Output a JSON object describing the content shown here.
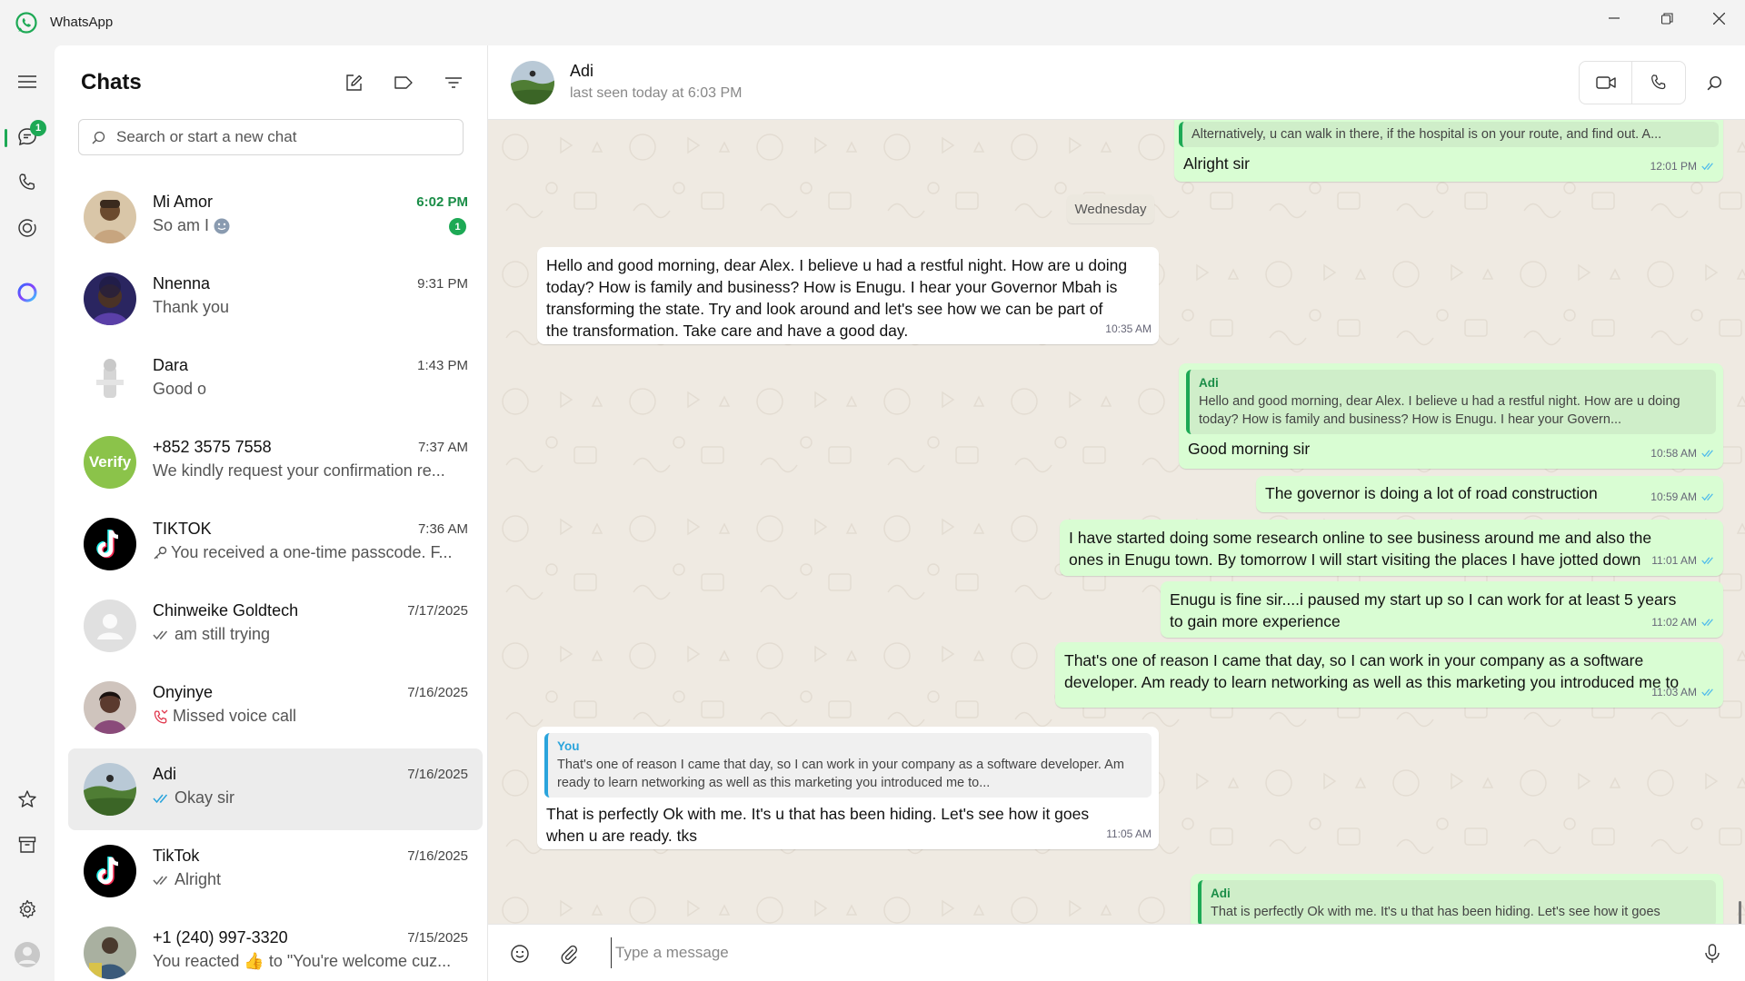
{
  "app": {
    "title": "WhatsApp"
  },
  "rail": {
    "chats_badge": "1"
  },
  "chats_panel": {
    "title": "Chats",
    "search_placeholder": "Search or start a new chat",
    "items": [
      {
        "name": "Mi Amor",
        "time": "6:02 PM",
        "preview": "So am I",
        "unread": "1",
        "avatar_color": "#b89a7a"
      },
      {
        "name": "Nnenna",
        "time": "9:31 PM",
        "preview": "Thank you",
        "avatar_color": "#3a2f6b"
      },
      {
        "name": "Dara",
        "time": "1:43 PM",
        "preview": "Good o",
        "avatar_color": "#e8e8e8"
      },
      {
        "name": "+852 3575 7558",
        "time": "7:37 AM",
        "preview": "We kindly request your confirmation re...",
        "avatar_color": "#8bc34a",
        "avatar_text": "Verify"
      },
      {
        "name": "TIKTOK",
        "time": "7:36 AM",
        "preview": "You received a one-time passcode. F...",
        "avatar_color": "#000000"
      },
      {
        "name": "Chinweike Goldtech",
        "time": "7/17/2025",
        "preview": "am still trying",
        "avatar_color": "#dddddd"
      },
      {
        "name": "Onyinye",
        "time": "7/16/2025",
        "preview": "Missed voice call",
        "avatar_color": "#5b3a2e"
      },
      {
        "name": "Adi",
        "time": "7/16/2025",
        "preview": "Okay sir",
        "avatar_color": "#5a8a3a"
      },
      {
        "name": "TikTok",
        "time": "7/16/2025",
        "preview": "Alright",
        "avatar_color": "#000000"
      },
      {
        "name": "+1 (240) 997-3320",
        "time": "7/15/2025",
        "preview": "You reacted 👍 to \"You're welcome cuz...",
        "avatar_color": "#7a8a6a"
      }
    ]
  },
  "conversation": {
    "name": "Adi",
    "status": "last seen today at 6:03 PM",
    "day_label": "Wednesday",
    "composer_placeholder": "Type a message",
    "messages": {
      "m1_quote": "Alternatively, u can walk in there, if the hospital is on your route, and find out.  A...",
      "m1_text": "Alright sir",
      "m1_time": "12:01 PM",
      "m2_text": "Hello and good morning, dear Alex.  I believe u had a restful night.  How are u doing today?  How is family and business?  How is Enugu.  I hear your Governor Mbah is transforming the state.   Try and look around and let's see how we can be part of the transformation. Take care and have a good day.",
      "m2_time": "10:35 AM",
      "m3_quote_author": "Adi",
      "m3_quote": "Hello and good morning, dear Alex.  I believe u had a restful night.  How are u doing today?  How is family and business?  How is Enugu.  I hear your Govern...",
      "m3_text": "Good morning sir",
      "m3_time": "10:58 AM",
      "m4_text": "The governor is doing a lot of road construction",
      "m4_time": "10:59 AM",
      "m5_text": "I have started doing some research online to see business around me and also the ones in Enugu town. By tomorrow I will start visiting the places I have jotted down",
      "m5_time": "11:01 AM",
      "m6_text": "Enugu is fine sir....i paused my start up so I can work for at least 5 years to gain more experience",
      "m6_time": "11:02 AM",
      "m7_text": "That's one of reason I came that day, so I can work in your company as a software developer. Am ready to learn networking as well as this marketing you introduced me to",
      "m7_time": "11:03 AM",
      "m8_quote_author": "You",
      "m8_quote": "That's one of reason I came that day, so I can work in your company as a software developer. Am ready to learn networking as well as this marketing you introduced me to...",
      "m8_text": "That is perfectly Ok with me.  It's u that has been hiding.  Let's see how it goes when u are ready. tks",
      "m8_time": "11:05 AM",
      "m9_quote_author": "Adi",
      "m9_quote": "That is perfectly Ok with me.  It's u that has been hiding.  Let's see how it goes"
    }
  },
  "colors": {
    "accent": "#1da955",
    "outgoing": "#d9fdd3",
    "read_tick": "#53bdeb"
  }
}
